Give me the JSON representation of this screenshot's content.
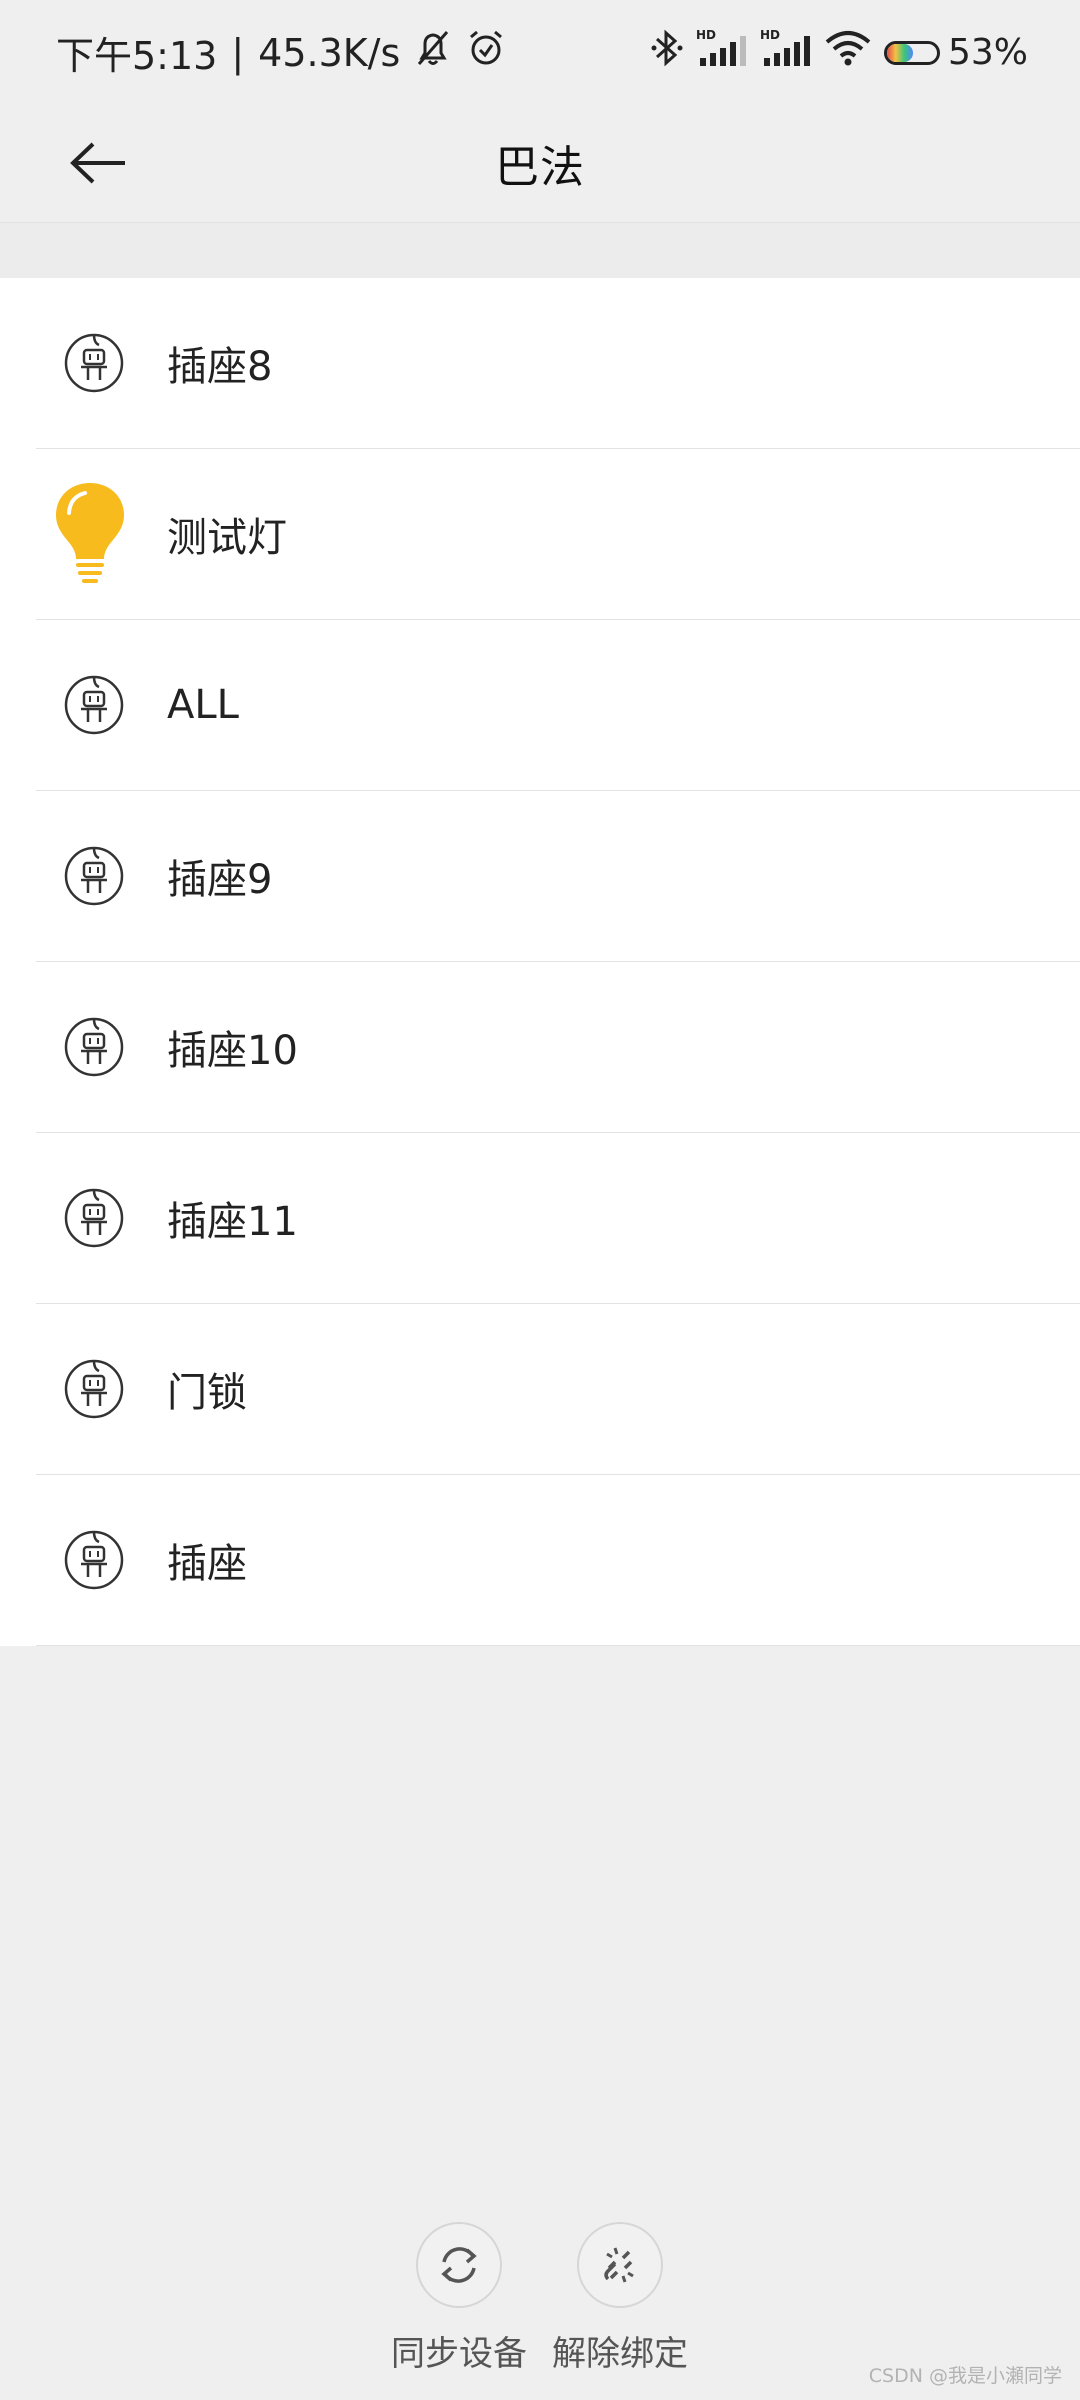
{
  "status_bar": {
    "time": "下午5:13",
    "separator": "|",
    "speed": "45.3K/s",
    "battery_percent": "53%",
    "battery_level": 0.53,
    "hd_label_1": "HD",
    "hd_label_2": "HD"
  },
  "header": {
    "title": "巴法"
  },
  "devices": [
    {
      "label": "插座8",
      "icon": "socket-icon"
    },
    {
      "label": "测试灯",
      "icon": "bulb-icon"
    },
    {
      "label": "ALL",
      "icon": "socket-icon"
    },
    {
      "label": "插座9",
      "icon": "socket-icon"
    },
    {
      "label": "插座10",
      "icon": "socket-icon"
    },
    {
      "label": "插座11",
      "icon": "socket-icon"
    },
    {
      "label": "门锁",
      "icon": "socket-icon"
    },
    {
      "label": "插座",
      "icon": "socket-icon"
    }
  ],
  "actions": {
    "sync_label": "同步设备",
    "unbind_label": "解除绑定"
  },
  "watermark": "CSDN @我是小瀬同学",
  "colors": {
    "background": "#efefef",
    "list_background": "#ffffff",
    "bulb": "#f7bb1e",
    "text": "#222222"
  }
}
